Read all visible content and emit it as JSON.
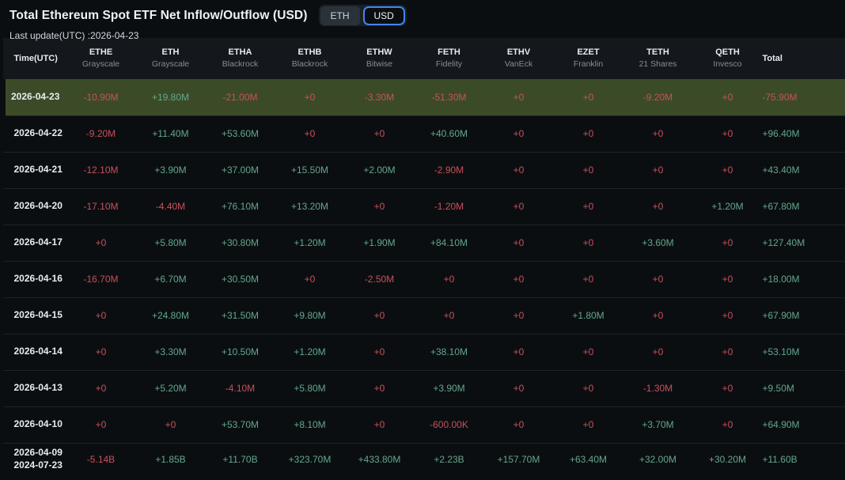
{
  "header": {
    "title": "Total Ethereum Spot ETF Net Inflow/Outflow (USD)",
    "last_update": "Last update(UTC) :2026-04-23",
    "toggle": {
      "eth_label": "ETH",
      "usd_label": "USD",
      "selected": "USD"
    }
  },
  "colors": {
    "positive_text": "#62a78c",
    "negative_text": "#c9505b",
    "highlight_row_bg": "#3b4b28",
    "accent_blue": "#4285f4",
    "page_bg": "#0b0e11",
    "table_header_bg": "#14181d"
  },
  "table": {
    "time_column_label": "Time(UTC)",
    "total_column_label": "Total",
    "columns": [
      {
        "ticker": "ETHE",
        "issuer": "Grayscale"
      },
      {
        "ticker": "ETH",
        "issuer": "Grayscale"
      },
      {
        "ticker": "ETHA",
        "issuer": "Blackrock"
      },
      {
        "ticker": "ETHB",
        "issuer": "Blackrock"
      },
      {
        "ticker": "ETHW",
        "issuer": "Bitwise"
      },
      {
        "ticker": "FETH",
        "issuer": "Fidelity"
      },
      {
        "ticker": "ETHV",
        "issuer": "VanEck"
      },
      {
        "ticker": "EZET",
        "issuer": "Franklin"
      },
      {
        "ticker": "TETH",
        "issuer": "21 Shares"
      },
      {
        "ticker": "QETH",
        "issuer": "Invesco"
      }
    ],
    "rows": [
      {
        "date": "2026-04-23",
        "date2": "",
        "highlighted": true,
        "values": [
          "-10.90M",
          "+19.80M",
          "-21.00M",
          "+0",
          "-3.30M",
          "-51.30M",
          "+0",
          "+0",
          "-9.20M",
          "+0",
          "-75.90M"
        ]
      },
      {
        "date": "2026-04-22",
        "date2": "",
        "highlighted": false,
        "values": [
          "-9.20M",
          "+11.40M",
          "+53.60M",
          "+0",
          "+0",
          "+40.60M",
          "+0",
          "+0",
          "+0",
          "+0",
          "+96.40M"
        ]
      },
      {
        "date": "2026-04-21",
        "date2": "",
        "highlighted": false,
        "values": [
          "-12.10M",
          "+3.90M",
          "+37.00M",
          "+15.50M",
          "+2.00M",
          "-2.90M",
          "+0",
          "+0",
          "+0",
          "+0",
          "+43.40M"
        ]
      },
      {
        "date": "2026-04-20",
        "date2": "",
        "highlighted": false,
        "values": [
          "-17.10M",
          "-4.40M",
          "+76.10M",
          "+13.20M",
          "+0",
          "-1.20M",
          "+0",
          "+0",
          "+0",
          "+1.20M",
          "+67.80M"
        ]
      },
      {
        "date": "2026-04-17",
        "date2": "",
        "highlighted": false,
        "values": [
          "+0",
          "+5.80M",
          "+30.80M",
          "+1.20M",
          "+1.90M",
          "+84.10M",
          "+0",
          "+0",
          "+3.60M",
          "+0",
          "+127.40M"
        ]
      },
      {
        "date": "2026-04-16",
        "date2": "",
        "highlighted": false,
        "values": [
          "-16.70M",
          "+6.70M",
          "+30.50M",
          "+0",
          "-2.50M",
          "+0",
          "+0",
          "+0",
          "+0",
          "+0",
          "+18.00M"
        ]
      },
      {
        "date": "2026-04-15",
        "date2": "",
        "highlighted": false,
        "values": [
          "+0",
          "+24.80M",
          "+31.50M",
          "+9.80M",
          "+0",
          "+0",
          "+0",
          "+1.80M",
          "+0",
          "+0",
          "+67.90M"
        ]
      },
      {
        "date": "2026-04-14",
        "date2": "",
        "highlighted": false,
        "values": [
          "+0",
          "+3.30M",
          "+10.50M",
          "+1.20M",
          "+0",
          "+38.10M",
          "+0",
          "+0",
          "+0",
          "+0",
          "+53.10M"
        ]
      },
      {
        "date": "2026-04-13",
        "date2": "",
        "highlighted": false,
        "values": [
          "+0",
          "+5.20M",
          "-4.10M",
          "+5.80M",
          "+0",
          "+3.90M",
          "+0",
          "+0",
          "-1.30M",
          "+0",
          "+9.50M"
        ]
      },
      {
        "date": "2026-04-10",
        "date2": "",
        "highlighted": false,
        "values": [
          "+0",
          "+0",
          "+53.70M",
          "+8.10M",
          "+0",
          "-600.00K",
          "+0",
          "+0",
          "+3.70M",
          "+0",
          "+64.90M"
        ]
      },
      {
        "date": "2026-04-09",
        "date2": "2024-07-23",
        "highlighted": false,
        "values": [
          "-5.14B",
          "+1.85B",
          "+11.70B",
          "+323.70M",
          "+433.80M",
          "+2.23B",
          "+157.70M",
          "+63.40M",
          "+32.00M",
          "+30.20M",
          "+11.60B"
        ]
      }
    ]
  }
}
